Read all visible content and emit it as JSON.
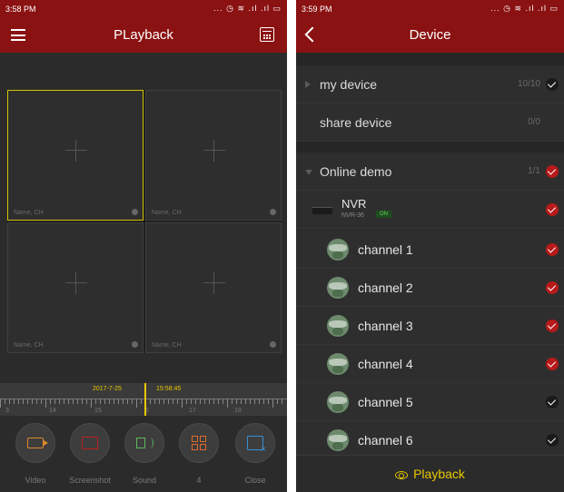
{
  "left": {
    "status": {
      "time": "3:58 PM",
      "icons": "... ◷ ≋ .ıl .ıl ▭"
    },
    "title": "PLayback",
    "cells": [
      {
        "name": "Name, CH"
      },
      {
        "name": "Name, CH"
      },
      {
        "name": "Name, CH"
      },
      {
        "name": "Name, CH"
      }
    ],
    "timeline": {
      "date": "2017-7-25",
      "time": "15:58:45",
      "hour_labels": [
        "3",
        "14",
        "15",
        "6",
        "17",
        "18"
      ]
    },
    "controls": [
      {
        "label": "Video"
      },
      {
        "label": "Screenshot"
      },
      {
        "label": "Sound"
      },
      {
        "label": "4"
      },
      {
        "label": "Close"
      }
    ],
    "colors": {
      "brand": "#8b1212",
      "accent": "#e8c800"
    }
  },
  "right": {
    "status": {
      "time": "3:59 PM",
      "icons": "... ◷ ≋ .ıl .ıl ▭"
    },
    "title": "Device",
    "groups": [
      {
        "label": "my device",
        "count": "10/10",
        "checked": "dark"
      },
      {
        "label": "share device",
        "count": "0/0"
      }
    ],
    "online": {
      "label": "Online demo",
      "count": "1/1",
      "checked": "red"
    },
    "nvr": {
      "name": "NVR",
      "model": "NVR-36",
      "badge": "ON"
    },
    "channels": [
      {
        "label": "channel 1",
        "check": "red"
      },
      {
        "label": "channel 2",
        "check": "red"
      },
      {
        "label": "channel 3",
        "check": "red"
      },
      {
        "label": "channel 4",
        "check": "red"
      },
      {
        "label": "channel 5",
        "check": "dark"
      },
      {
        "label": "channel 6",
        "check": "dark"
      }
    ],
    "playback_label": "Playback"
  }
}
